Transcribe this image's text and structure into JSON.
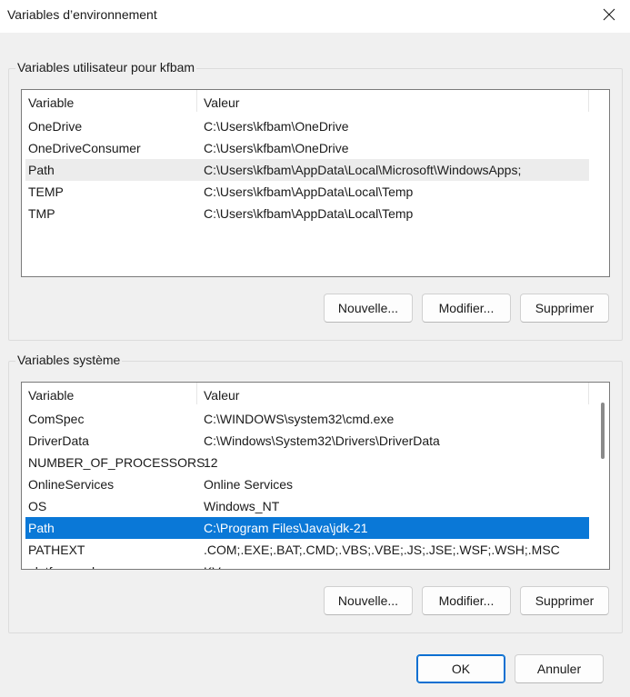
{
  "window": {
    "title": "Variables d’environnement"
  },
  "user_section": {
    "label": "Variables utilisateur pour kfbam",
    "columns": [
      "Variable",
      "Valeur"
    ],
    "rows": [
      {
        "name": "OneDrive",
        "value": "C:\\Users\\kfbam\\OneDrive"
      },
      {
        "name": "OneDriveConsumer",
        "value": "C:\\Users\\kfbam\\OneDrive"
      },
      {
        "name": "Path",
        "value": "C:\\Users\\kfbam\\AppData\\Local\\Microsoft\\WindowsApps;"
      },
      {
        "name": "TEMP",
        "value": "C:\\Users\\kfbam\\AppData\\Local\\Temp"
      },
      {
        "name": "TMP",
        "value": "C:\\Users\\kfbam\\AppData\\Local\\Temp"
      }
    ],
    "buttons": {
      "new": "Nouvelle...",
      "edit": "Modifier...",
      "delete": "Supprimer"
    }
  },
  "system_section": {
    "label": "Variables système",
    "columns": [
      "Variable",
      "Valeur"
    ],
    "rows": [
      {
        "name": "ComSpec",
        "value": "C:\\WINDOWS\\system32\\cmd.exe"
      },
      {
        "name": "DriverData",
        "value": "C:\\Windows\\System32\\Drivers\\DriverData"
      },
      {
        "name": "NUMBER_OF_PROCESSORS",
        "value": "12"
      },
      {
        "name": "OnlineServices",
        "value": "Online Services"
      },
      {
        "name": "OS",
        "value": "Windows_NT"
      },
      {
        "name": "Path",
        "value": "C:\\Program Files\\Java\\jdk-21"
      },
      {
        "name": "PATHEXT",
        "value": ".COM;.EXE;.BAT;.CMD;.VBS;.VBE;.JS;.JSE;.WSF;.WSH;.MSC"
      },
      {
        "name": "platformcode",
        "value": "KV"
      }
    ],
    "buttons": {
      "new": "Nouvelle...",
      "edit": "Modifier...",
      "delete": "Supprimer"
    }
  },
  "footer": {
    "ok": "OK",
    "cancel": "Annuler"
  },
  "colors": {
    "selection": "#0a78d7",
    "hover": "#ececec",
    "background": "#f0f0f0"
  },
  "icons": {
    "close": "close-icon"
  }
}
